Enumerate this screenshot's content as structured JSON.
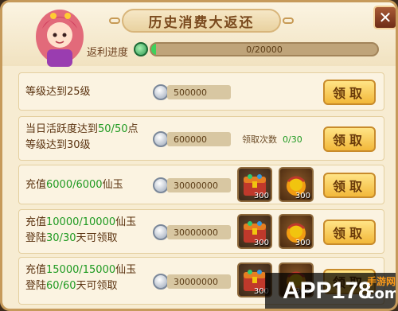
{
  "header": {
    "title": "历史消费大返还",
    "close_label": "✕"
  },
  "progress": {
    "label": "返利进度",
    "current": 0,
    "max": 20000,
    "text": "0/20000",
    "fill_fraction": 0.01
  },
  "rows": [
    {
      "line1_pre": "等级达到25级",
      "line1_hl": "",
      "line1_post": "",
      "line2_pre": "",
      "line2_hl": "",
      "line2_post": "",
      "amount": "500000",
      "button": "领取"
    },
    {
      "line1_pre": "当日活跃度达到",
      "line1_hl": "50/50",
      "line1_post": "点",
      "line2_pre": "等级达到30级",
      "line2_hl": "",
      "line2_post": "",
      "amount": "600000",
      "claim_label": "领取次数",
      "claim_value": "0/30",
      "button": "领取"
    },
    {
      "line1_pre": "充值",
      "line1_hl": "6000/6000",
      "line1_post": "仙玉",
      "amount": "30000000",
      "reward_qty_1": "300",
      "reward_qty_2": "300",
      "button": "领取"
    },
    {
      "line1_pre": "充值",
      "line1_hl": "10000/10000",
      "line1_post": "仙玉",
      "line2_pre": "登陆",
      "line2_hl": "30/30",
      "line2_post": "天可领取",
      "amount": "30000000",
      "reward_qty_1": "300",
      "reward_qty_2": "300",
      "button": "领取"
    },
    {
      "line1_pre": "充值",
      "line1_hl": "15000/15000",
      "line1_post": "仙玉",
      "line2_pre": "登陆",
      "line2_hl": "60/60",
      "line2_post": "天可领取",
      "amount": "30000000",
      "reward_qty_1": "300",
      "reward_qty_2": "300",
      "button": "领取"
    }
  ],
  "watermark": {
    "brand": "APP178",
    "suffix": ".com",
    "tag": "手游网"
  },
  "colors": {
    "highlight": "#1f9a21",
    "button_gold": "#f2b83a",
    "panel_bg": "#f7ecd2"
  }
}
